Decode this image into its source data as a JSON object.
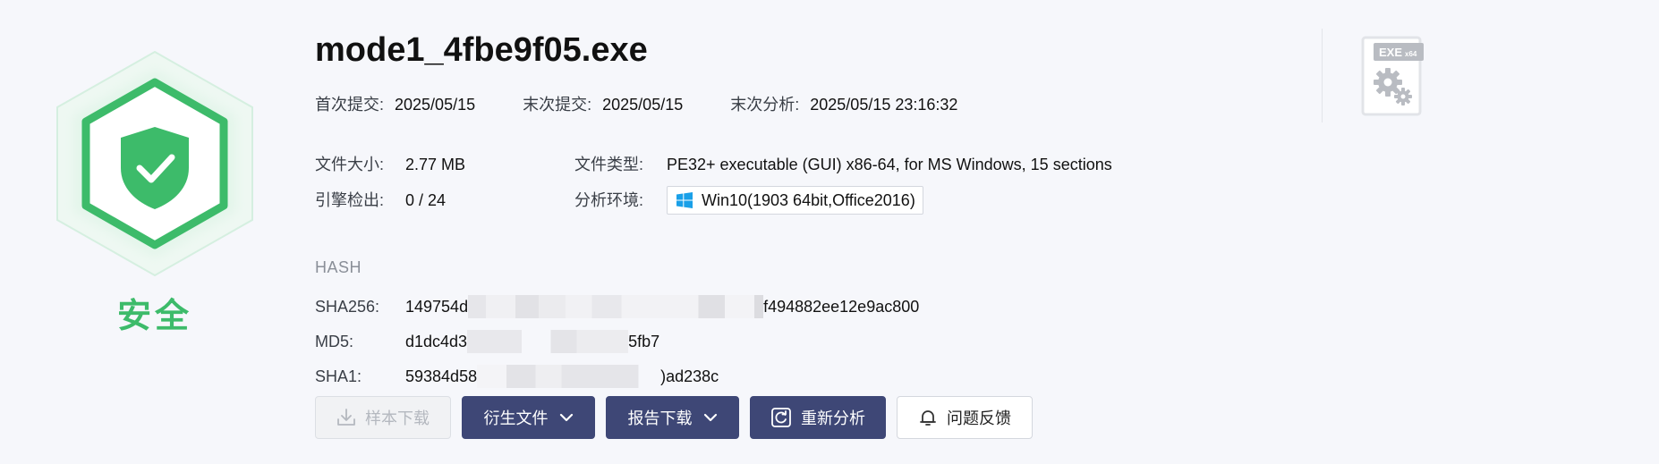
{
  "verdict": {
    "label": "安全",
    "icon": "shield-check-icon",
    "color": "#3dbb6a"
  },
  "file": {
    "name": "mode1_4fbe9f05.exe",
    "icon": "exe-x64-file-icon",
    "icon_badge": "EXE",
    "icon_badge_sub": "x64"
  },
  "dates": {
    "first_submit_label": "首次提交:",
    "first_submit": "2025/05/15",
    "last_submit_label": "末次提交:",
    "last_submit": "2025/05/15",
    "last_analysis_label": "末次分析:",
    "last_analysis": "2025/05/15 23:16:32"
  },
  "info": {
    "size_label": "文件大小:",
    "size": "2.77 MB",
    "type_label": "文件类型:",
    "type": "PE32+ executable (GUI) x86-64, for MS Windows, 15 sections",
    "detect_label": "引擎检出:",
    "detect": "0 / 24",
    "env_label": "分析环境:",
    "env": "Win10(1903 64bit,Office2016)",
    "env_icon": "windows-icon"
  },
  "hash": {
    "heading": "HASH",
    "sha256_label": "SHA256:",
    "sha256_start": "149754d",
    "sha256_end": "f494882ee12e9ac800",
    "md5_label": "MD5:",
    "md5_start": "d1dc4d3",
    "md5_end": "5fb7",
    "sha1_label": "SHA1:",
    "sha1_start": "59384d58",
    "sha1_end": ")ad238c"
  },
  "actions": {
    "download_sample": "样本下载",
    "derived_files": "衍生文件",
    "report_download": "报告下载",
    "reanalyze": "重新分析",
    "feedback": "问题反馈"
  },
  "colors": {
    "accent": "#3e4776",
    "safe": "#3dbb6a",
    "background": "#f6f7fb"
  }
}
